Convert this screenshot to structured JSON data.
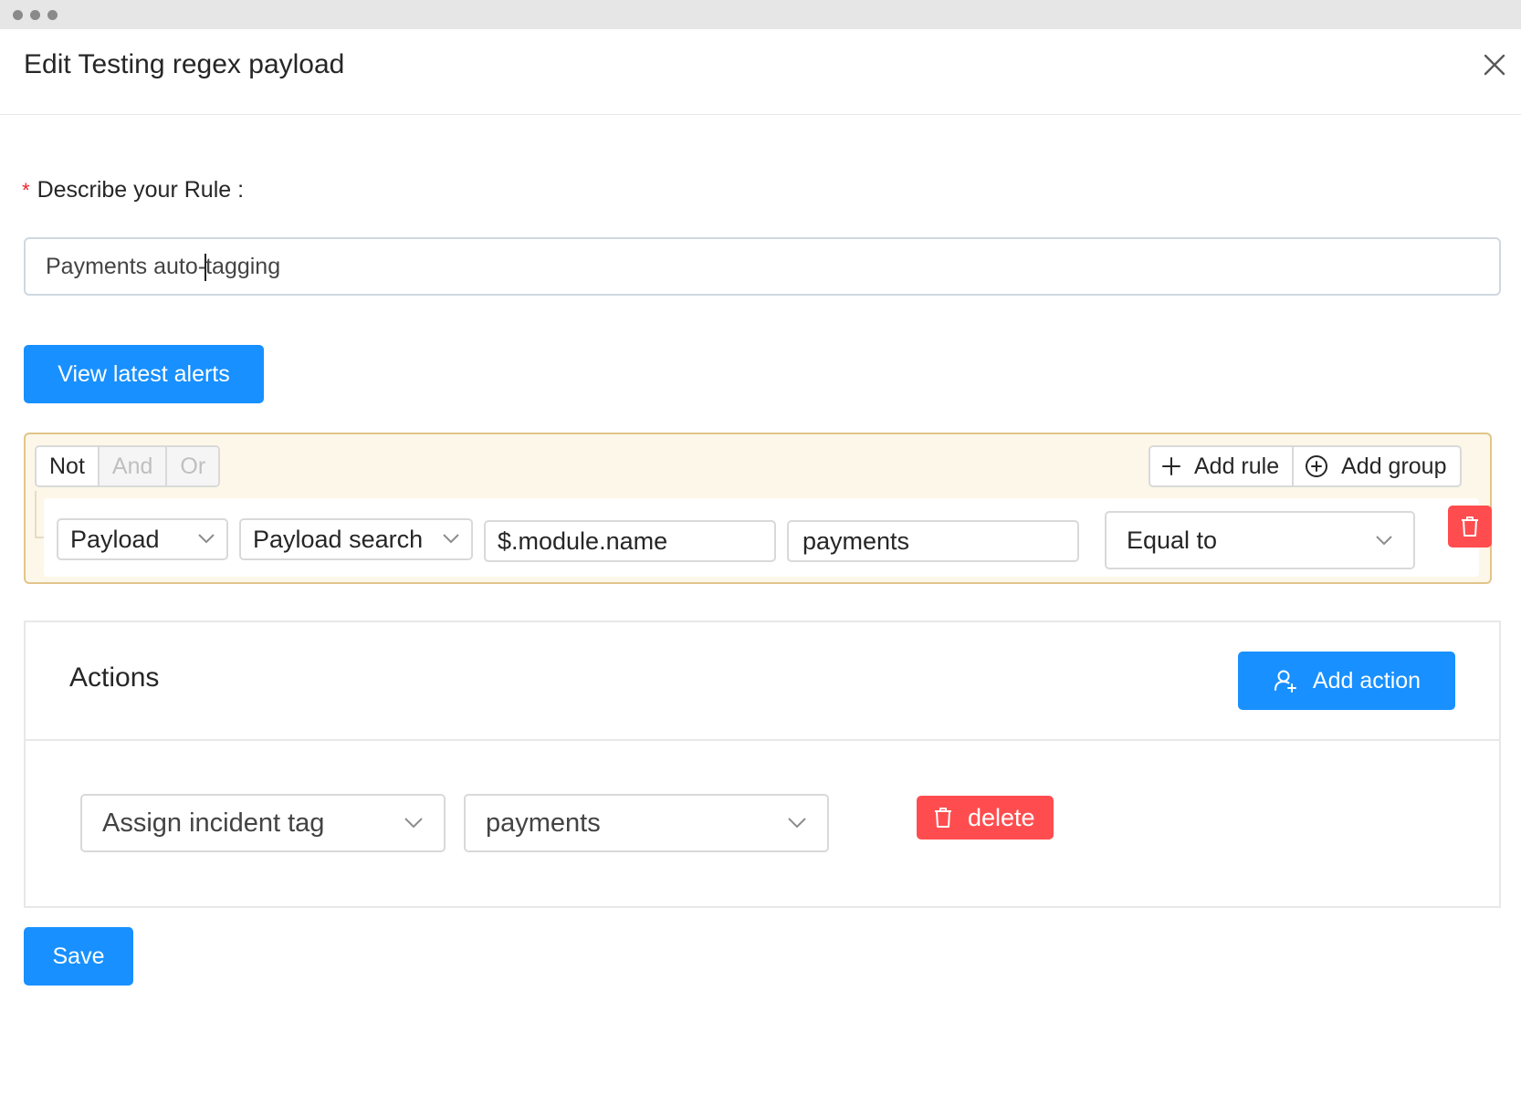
{
  "modal": {
    "title": "Edit Testing regex payload"
  },
  "form": {
    "required_mark": "*",
    "rule_label": "Describe your Rule :",
    "rule_value_before_caret": "Payments auto-",
    "rule_value_after_caret": "tagging"
  },
  "buttons": {
    "view_latest_alerts": "View latest alerts",
    "add_rule": "Add rule",
    "add_group": "Add group",
    "add_action": "Add action",
    "delete": "delete",
    "save": "Save"
  },
  "query": {
    "combinators": [
      {
        "label": "Not",
        "enabled": true
      },
      {
        "label": "And",
        "enabled": false
      },
      {
        "label": "Or",
        "enabled": false
      }
    ],
    "rule": {
      "field": "Payload",
      "operator_type": "Payload search",
      "path": "$.module.name",
      "value": "payments",
      "comparison": "Equal to"
    }
  },
  "actions": {
    "title": "Actions",
    "items": [
      {
        "action": "Assign incident tag",
        "value": "payments"
      }
    ]
  },
  "colors": {
    "primary": "#1890ff",
    "danger": "#ff4d4f",
    "query_border": "#e2c48a",
    "query_bg": "#fcf7e8"
  }
}
